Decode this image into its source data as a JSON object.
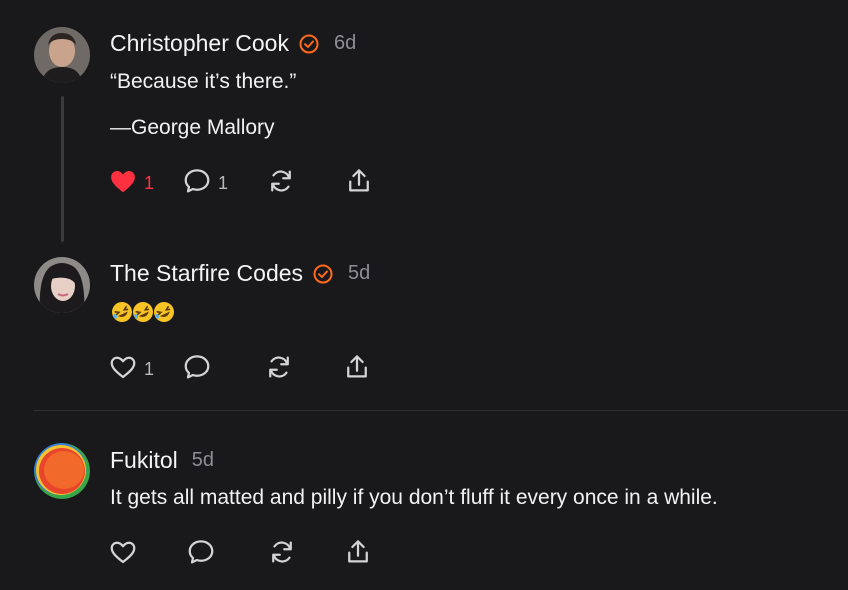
{
  "posts": [
    {
      "username": "Christopher Cook",
      "verified": true,
      "time": "6d",
      "lines": [
        "“Because it’s there.”",
        "—George Mallory"
      ],
      "likes": "1",
      "liked": true,
      "replies": "1"
    },
    {
      "username": "The Starfire Codes",
      "verified": true,
      "time": "5d",
      "emoji_count": 3,
      "likes": "1",
      "liked": false,
      "replies": ""
    },
    {
      "username": "Fukitol",
      "verified": false,
      "time": "5d",
      "lines": [
        "It gets all matted and pilly if you don’t fluff it every once in a while."
      ],
      "likes": "",
      "liked": false,
      "replies": ""
    }
  ],
  "colors": {
    "accent": "#ff6a1a",
    "like": "#ff3040",
    "background": "#19191b"
  },
  "icons": [
    "verified-badge-icon",
    "heart-icon",
    "comment-icon",
    "repost-icon",
    "share-icon",
    "rolling-laughing-emoji"
  ]
}
